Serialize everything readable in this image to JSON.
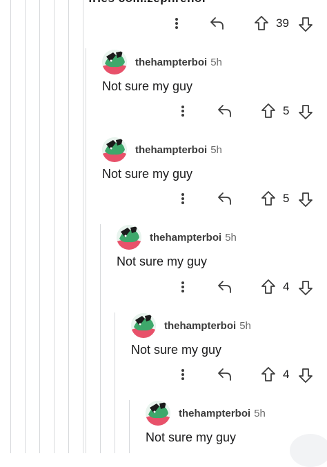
{
  "thread": {
    "truncated_parent_text": "fries com.zephrenoi",
    "parent_actions": {
      "score": "39"
    },
    "comments": [
      {
        "username": "thehampterboi",
        "age": "5h",
        "body": "Not sure my guy",
        "score": "5"
      },
      {
        "username": "thehampterboi",
        "age": "5h",
        "body": "Not sure my guy",
        "score": "5"
      },
      {
        "username": "thehampterboi",
        "age": "5h",
        "body": "Not sure my guy",
        "score": "4"
      },
      {
        "username": "thehampterboi",
        "age": "5h",
        "body": "Not sure my guy",
        "score": "4"
      },
      {
        "username": "thehampterboi",
        "age": "5h",
        "body": "Not sure my guy"
      }
    ]
  },
  "icons": {
    "more": "more-vertical-icon",
    "reply": "reply-arrow-icon",
    "upvote": "upvote-arrow-icon",
    "downvote": "downvote-arrow-icon",
    "avatar": "hamster-avatar-icon"
  },
  "colors": {
    "thread_line": "#d7d9dc",
    "text": "#1a1a1b",
    "avatar_green": "#3ea86b",
    "avatar_pink": "#e8516a"
  }
}
